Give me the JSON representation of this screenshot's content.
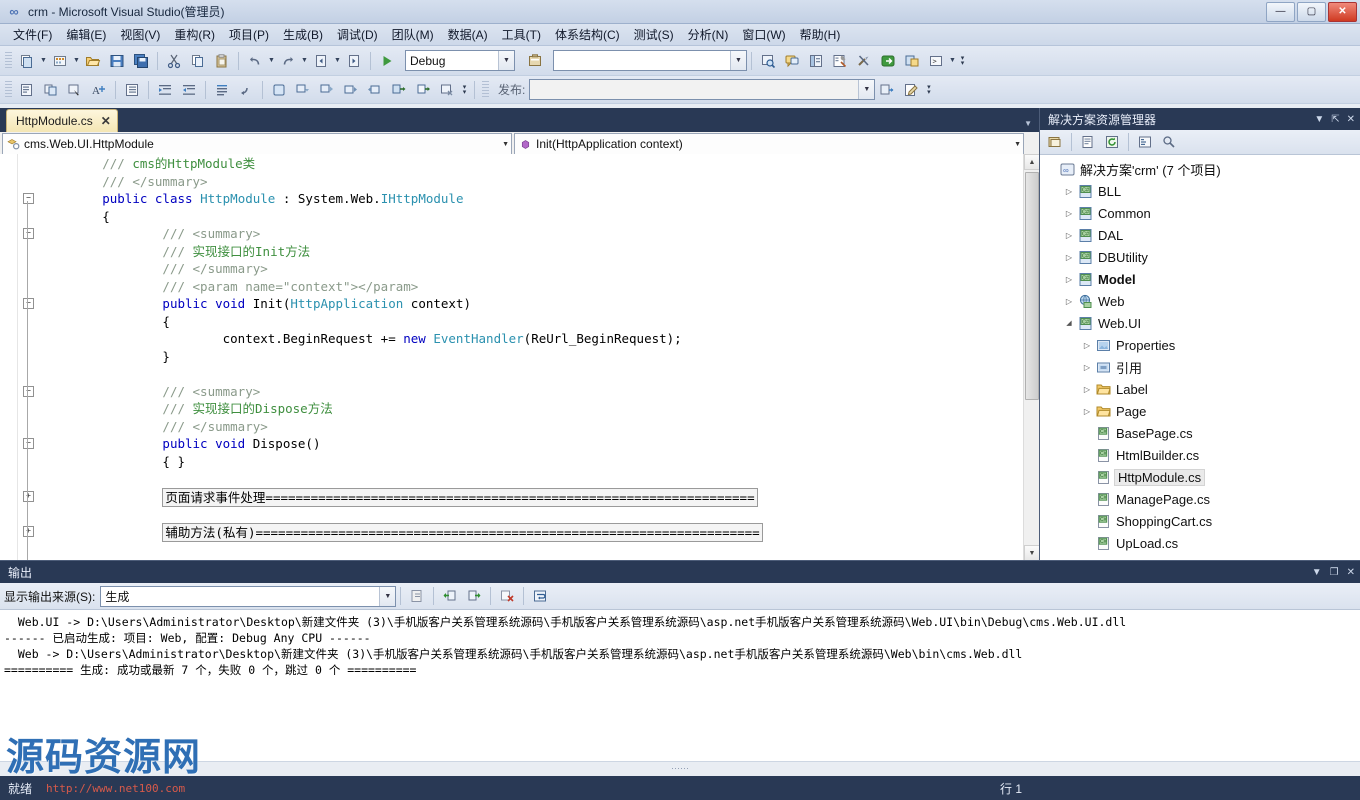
{
  "window": {
    "title": "crm - Microsoft Visual Studio(管理员)",
    "app_icon": "visual-studio-icon",
    "buttons": {
      "minimize": "—",
      "maximize": "▢",
      "close": "✕"
    }
  },
  "menubar": {
    "items": [
      {
        "label": "文件(F)"
      },
      {
        "label": "编辑(E)"
      },
      {
        "label": "视图(V)"
      },
      {
        "label": "重构(R)"
      },
      {
        "label": "项目(P)"
      },
      {
        "label": "生成(B)"
      },
      {
        "label": "调试(D)"
      },
      {
        "label": "团队(M)"
      },
      {
        "label": "数据(A)"
      },
      {
        "label": "工具(T)"
      },
      {
        "label": "体系结构(C)"
      },
      {
        "label": "测试(S)"
      },
      {
        "label": "分析(N)"
      },
      {
        "label": "窗口(W)"
      },
      {
        "label": "帮助(H)"
      }
    ]
  },
  "toolbar_standard": {
    "config_combo": {
      "value": "Debug"
    },
    "find_combo": {
      "value": "",
      "placeholder": ""
    },
    "icons": [
      "new-project-icon",
      "add-new-item-icon",
      "open-file-icon",
      "save-icon",
      "save-all-icon",
      "cut-icon",
      "copy-icon",
      "paste-icon",
      "undo-icon",
      "redo-icon",
      "navigate-backward-icon",
      "navigate-forward-icon",
      "start-debugging-icon",
      "find-in-files-icon",
      "solution-explorer-icon",
      "properties-window-icon",
      "object-browser-icon",
      "toolbox-icon",
      "team-explorer-icon",
      "error-list-icon",
      "command-window-icon"
    ]
  },
  "toolbar_text_editor": {
    "publish_label": "发布:",
    "publish_combo": {
      "value": ""
    },
    "icons": [
      "display-tag-icon",
      "preview-changes-icon",
      "navigate-icon",
      "font-size-icon",
      "toggle-outline-icon",
      "indent-icon",
      "outdent-icon",
      "comment-icon",
      "uncomment-icon",
      "bookmark-window-icon",
      "toggle-bookmark-icon",
      "prev-bookmark-icon",
      "next-bookmark-icon",
      "prev-bookmark-folder-icon",
      "next-bookmark-folder-icon",
      "clear-bookmarks-icon"
    ]
  },
  "editor": {
    "tab": {
      "label": "HttpModule.cs",
      "close": "✕",
      "active": true
    },
    "type_combo": {
      "value": "cms.Web.UI.HttpModule",
      "icon": "class-icon"
    },
    "member_combo": {
      "value": "Init(HttpApplication context)",
      "icon": "method-icon"
    },
    "lines": [
      {
        "indent": 8,
        "segments": [
          {
            "t": "/// ",
            "c": "cmtgray"
          },
          {
            "t": "cms的HttpModule类",
            "c": "cmt"
          }
        ]
      },
      {
        "indent": 8,
        "segments": [
          {
            "t": "/// ",
            "c": "cmtgray"
          },
          {
            "t": "</summary>",
            "c": "cmtgray"
          }
        ]
      },
      {
        "indent": 8,
        "fold": "minus",
        "segments": [
          {
            "t": "public class ",
            "c": "kw"
          },
          {
            "t": "HttpModule",
            "c": "ty"
          },
          {
            "t": " : System.Web.",
            "c": "plain"
          },
          {
            "t": "IHttpModule",
            "c": "ty"
          }
        ]
      },
      {
        "indent": 8,
        "segments": [
          {
            "t": "{",
            "c": "plain"
          }
        ]
      },
      {
        "indent": 16,
        "fold": "minus",
        "segments": [
          {
            "t": "/// ",
            "c": "cmtgray"
          },
          {
            "t": "<summary>",
            "c": "cmtgray"
          }
        ]
      },
      {
        "indent": 16,
        "segments": [
          {
            "t": "/// ",
            "c": "cmtgray"
          },
          {
            "t": "实现接口的Init方法",
            "c": "cmt"
          }
        ]
      },
      {
        "indent": 16,
        "segments": [
          {
            "t": "/// ",
            "c": "cmtgray"
          },
          {
            "t": "</summary>",
            "c": "cmtgray"
          }
        ]
      },
      {
        "indent": 16,
        "segments": [
          {
            "t": "/// ",
            "c": "cmtgray"
          },
          {
            "t": "<param name=\"context\"></param>",
            "c": "cmtgray"
          }
        ]
      },
      {
        "indent": 16,
        "fold": "minus",
        "segments": [
          {
            "t": "public void ",
            "c": "kw"
          },
          {
            "t": "Init(",
            "c": "plain"
          },
          {
            "t": "HttpApplication",
            "c": "ty"
          },
          {
            "t": " context)",
            "c": "plain"
          }
        ]
      },
      {
        "indent": 16,
        "segments": [
          {
            "t": "{",
            "c": "plain"
          }
        ]
      },
      {
        "indent": 24,
        "segments": [
          {
            "t": "context.BeginRequest += ",
            "c": "plain"
          },
          {
            "t": "new ",
            "c": "kw"
          },
          {
            "t": "EventHandler",
            "c": "ty"
          },
          {
            "t": "(ReUrl_BeginRequest);",
            "c": "plain"
          }
        ]
      },
      {
        "indent": 16,
        "segments": [
          {
            "t": "}",
            "c": "plain"
          }
        ]
      },
      {
        "indent": 0,
        "segments": []
      },
      {
        "indent": 16,
        "fold": "minus",
        "segments": [
          {
            "t": "/// ",
            "c": "cmtgray"
          },
          {
            "t": "<summary>",
            "c": "cmtgray"
          }
        ]
      },
      {
        "indent": 16,
        "segments": [
          {
            "t": "/// ",
            "c": "cmtgray"
          },
          {
            "t": "实现接口的Dispose方法",
            "c": "cmt"
          }
        ]
      },
      {
        "indent": 16,
        "segments": [
          {
            "t": "/// ",
            "c": "cmtgray"
          },
          {
            "t": "</summary>",
            "c": "cmtgray"
          }
        ]
      },
      {
        "indent": 16,
        "fold": "minus",
        "segments": [
          {
            "t": "public void ",
            "c": "kw"
          },
          {
            "t": "Dispose()",
            "c": "plain"
          }
        ]
      },
      {
        "indent": 16,
        "segments": [
          {
            "t": "{ }",
            "c": "plain"
          }
        ]
      },
      {
        "indent": 0,
        "segments": []
      },
      {
        "indent": 16,
        "fold": "plus",
        "region": "页面请求事件处理================================================================="
      },
      {
        "indent": 0,
        "segments": []
      },
      {
        "indent": 16,
        "fold": "plus",
        "region": "辅助方法(私有)==================================================================="
      },
      {
        "indent": 0,
        "segments": []
      },
      {
        "indent": 8,
        "segments": [
          {
            "t": "}",
            "c": "plain"
          }
        ]
      }
    ]
  },
  "solution_explorer": {
    "title": "解决方案资源管理器",
    "header_icons": [
      "chevron-down-icon",
      "pin-icon",
      "close-icon"
    ],
    "toolbar_icons": [
      "properties-icon",
      "show-all-files-icon",
      "refresh-icon",
      "view-code-icon",
      "view-designer-icon"
    ],
    "root": {
      "label": "解决方案'crm' (7 个项目)",
      "icon": "solution-icon"
    },
    "tree": [
      {
        "label": "BLL",
        "icon": "csharp-project-icon",
        "indent": 1,
        "expander": "collapsed",
        "bold": false,
        "selected": false
      },
      {
        "label": "Common",
        "icon": "csharp-project-icon",
        "indent": 1,
        "expander": "collapsed",
        "bold": false,
        "selected": false
      },
      {
        "label": "DAL",
        "icon": "csharp-project-icon",
        "indent": 1,
        "expander": "collapsed",
        "bold": false,
        "selected": false
      },
      {
        "label": "DBUtility",
        "icon": "csharp-project-icon",
        "indent": 1,
        "expander": "collapsed",
        "bold": false,
        "selected": false
      },
      {
        "label": "Model",
        "icon": "csharp-project-icon",
        "indent": 1,
        "expander": "collapsed",
        "bold": true,
        "selected": false
      },
      {
        "label": "Web",
        "icon": "web-project-icon",
        "indent": 1,
        "expander": "collapsed",
        "bold": false,
        "selected": false
      },
      {
        "label": "Web.UI",
        "icon": "csharp-project-icon",
        "indent": 1,
        "expander": "expanded",
        "bold": false,
        "selected": false
      },
      {
        "label": "Properties",
        "icon": "properties-folder-icon",
        "indent": 2,
        "expander": "collapsed",
        "bold": false,
        "selected": false
      },
      {
        "label": "引用",
        "icon": "references-icon",
        "indent": 2,
        "expander": "collapsed",
        "bold": false,
        "selected": false
      },
      {
        "label": "Label",
        "icon": "folder-icon",
        "indent": 2,
        "expander": "collapsed",
        "bold": false,
        "selected": false
      },
      {
        "label": "Page",
        "icon": "folder-icon",
        "indent": 2,
        "expander": "collapsed",
        "bold": false,
        "selected": false
      },
      {
        "label": "BasePage.cs",
        "icon": "csharp-file-icon",
        "indent": 2,
        "expander": "none",
        "bold": false,
        "selected": false
      },
      {
        "label": "HtmlBuilder.cs",
        "icon": "csharp-file-icon",
        "indent": 2,
        "expander": "none",
        "bold": false,
        "selected": false
      },
      {
        "label": "HttpModule.cs",
        "icon": "csharp-file-icon",
        "indent": 2,
        "expander": "none",
        "bold": false,
        "selected": true
      },
      {
        "label": "ManagePage.cs",
        "icon": "csharp-file-icon",
        "indent": 2,
        "expander": "none",
        "bold": false,
        "selected": false
      },
      {
        "label": "ShoppingCart.cs",
        "icon": "csharp-file-icon",
        "indent": 2,
        "expander": "none",
        "bold": false,
        "selected": false
      },
      {
        "label": "UpLoad.cs",
        "icon": "csharp-file-icon",
        "indent": 2,
        "expander": "none",
        "bold": false,
        "selected": false
      }
    ]
  },
  "output": {
    "title": "输出",
    "header_icons": [
      "chevron-down-icon",
      "float-icon",
      "close-icon"
    ],
    "source_label": "显示输出来源(S):",
    "source_combo": {
      "value": "生成"
    },
    "toolbar_icons": [
      "find-message-icon",
      "go-to-previous-icon",
      "go-to-next-icon",
      "clear-all-icon",
      "toggle-word-wrap-icon"
    ],
    "lines": [
      "  Web.UI -> D:\\Users\\Administrator\\Desktop\\新建文件夹 (3)\\手机版客户关系管理系统源码\\手机版客户关系管理系统源码\\asp.net手机版客户关系管理系统源码\\Web.UI\\bin\\Debug\\cms.Web.UI.dll",
      "------ 已启动生成: 项目: Web, 配置: Debug Any CPU ------",
      "  Web -> D:\\Users\\Administrator\\Desktop\\新建文件夹 (3)\\手机版客户关系管理系统源码\\手机版客户关系管理系统源码\\asp.net手机版客户关系管理系统源码\\Web\\bin\\cms.Web.dll",
      "========== 生成: 成功或最新 7 个，失败 0 个，跳过 0 个 =========="
    ]
  },
  "statusbar": {
    "ready": "就绪",
    "url": "http://www.net100.com",
    "line": "行 1"
  },
  "watermark": {
    "text": "源码资源网"
  },
  "colors": {
    "chrome_blue": "#293955",
    "panel_bg": "#f0f0f0",
    "accent": "#2f6fb5",
    "comment_green": "#3f8f3f",
    "keyword_blue": "#0000c0",
    "type_teal": "#2b91af",
    "tab_yellow": "#f4e6b4",
    "status_url_red": "#d85a4a"
  }
}
